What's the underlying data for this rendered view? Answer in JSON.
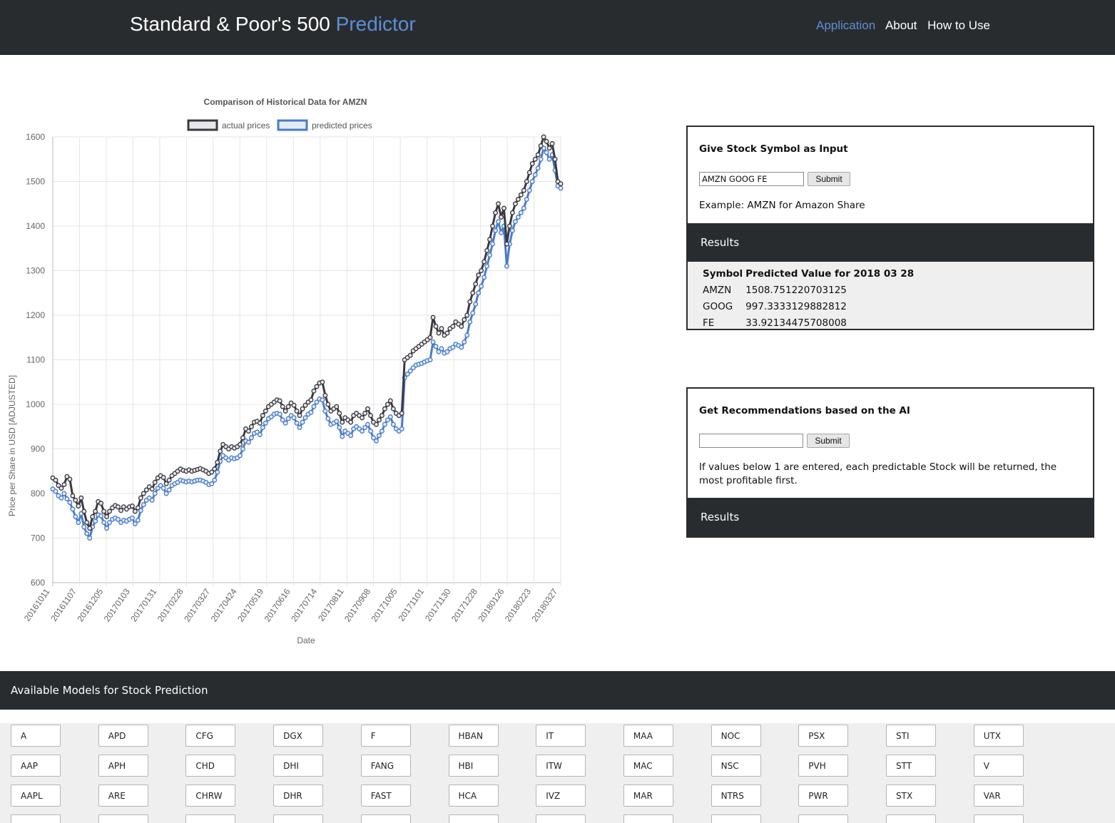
{
  "nav": {
    "brand_main": "Standard & Poor's 500",
    "brand_accent": "Predictor",
    "links": [
      "Application",
      "About",
      "How to Use"
    ],
    "active_link": "Application"
  },
  "chart_data": {
    "type": "line",
    "title": "Comparison of Historical Data for AMZN",
    "xlabel": "Date",
    "ylabel": "Price per Share in USD [ADJUSTED]",
    "ylim": [
      600,
      1600
    ],
    "yticks": [
      600,
      700,
      800,
      900,
      1000,
      1100,
      1200,
      1300,
      1400,
      1500,
      1600
    ],
    "xtick_labels": [
      "20161011",
      "20161107",
      "20161205",
      "20170103",
      "20170131",
      "20170228",
      "20170327",
      "20170424",
      "20170519",
      "20170616",
      "20170714",
      "20170811",
      "20170908",
      "20171005",
      "20171101",
      "20171130",
      "20171228",
      "20180126",
      "20180223",
      "20180327"
    ],
    "grid": true,
    "legend_position": "top",
    "series": [
      {
        "name": "actual prices",
        "color": "#3a3941",
        "values": [
          835,
          830,
          818,
          812,
          820,
          838,
          832,
          795,
          785,
          772,
          790,
          760,
          735,
          722,
          748,
          760,
          782,
          778,
          760,
          748,
          760,
          768,
          773,
          770,
          762,
          770,
          765,
          770,
          772,
          760,
          768,
          790,
          800,
          808,
          815,
          810,
          825,
          835,
          840,
          836,
          822,
          830,
          840,
          845,
          850,
          855,
          852,
          850,
          853,
          850,
          852,
          854,
          856,
          853,
          850,
          845,
          848,
          855,
          870,
          895,
          910,
          905,
          900,
          905,
          902,
          905,
          910,
          925,
          945,
          940,
          950,
          960,
          962,
          958,
          975,
          985,
          995,
          1000,
          1005,
          1010,
          1008,
          995,
          985,
          995,
          1003,
          998,
          985,
          975,
          990,
          998,
          1005,
          1010,
          1030,
          1040,
          1048,
          1050,
          1020,
          1000,
          985,
          990,
          995,
          980,
          960,
          970,
          965,
          960,
          975,
          980,
          975,
          970,
          980,
          990,
          975,
          960,
          955,
          965,
          975,
          990,
          1000,
          1008,
          990,
          980,
          975,
          980,
          1100,
          1105,
          1110,
          1120,
          1125,
          1130,
          1135,
          1140,
          1145,
          1150,
          1195,
          1175,
          1160,
          1170,
          1155,
          1160,
          1170,
          1175,
          1185,
          1180,
          1175,
          1190,
          1200,
          1230,
          1250,
          1270,
          1290,
          1300,
          1320,
          1345,
          1370,
          1400,
          1430,
          1450,
          1420,
          1440,
          1360,
          1400,
          1430,
          1450,
          1460,
          1470,
          1480,
          1500,
          1520,
          1540,
          1550,
          1560,
          1580,
          1600,
          1590,
          1575,
          1585,
          1550,
          1500,
          1495
        ]
      },
      {
        "name": "predicted prices",
        "color": "#4a7cc9",
        "values": [
          810,
          805,
          795,
          790,
          800,
          788,
          780,
          765,
          748,
          735,
          755,
          725,
          710,
          700,
          725,
          738,
          752,
          750,
          735,
          722,
          735,
          742,
          745,
          742,
          735,
          740,
          738,
          742,
          745,
          732,
          740,
          762,
          775,
          785,
          790,
          785,
          800,
          812,
          818,
          812,
          800,
          808,
          818,
          822,
          825,
          830,
          828,
          826,
          828,
          826,
          828,
          830,
          830,
          828,
          825,
          820,
          822,
          830,
          848,
          872,
          885,
          880,
          875,
          880,
          878,
          880,
          885,
          900,
          918,
          915,
          925,
          935,
          938,
          932,
          948,
          958,
          968,
          972,
          978,
          980,
          978,
          965,
          958,
          968,
          975,
          970,
          958,
          948,
          960,
          970,
          978,
          982,
          995,
          1005,
          1012,
          1010,
          985,
          968,
          955,
          958,
          962,
          948,
          928,
          940,
          935,
          930,
          945,
          950,
          945,
          940,
          948,
          955,
          940,
          925,
          918,
          930,
          940,
          955,
          965,
          972,
          955,
          945,
          940,
          945,
          1060,
          1068,
          1075,
          1082,
          1088,
          1090,
          1092,
          1095,
          1098,
          1100,
          1140,
          1130,
          1118,
          1125,
          1115,
          1118,
          1125,
          1128,
          1135,
          1132,
          1128,
          1140,
          1155,
          1185,
          1205,
          1225,
          1250,
          1265,
          1285,
          1310,
          1335,
          1360,
          1390,
          1410,
          1385,
          1400,
          1310,
          1360,
          1390,
          1410,
          1420,
          1430,
          1440,
          1460,
          1480,
          1500,
          1515,
          1530,
          1550,
          1575,
          1565,
          1550,
          1560,
          1525,
          1490,
          1485
        ]
      }
    ]
  },
  "input_panel": {
    "title": "Give Stock Symbol as Input",
    "input_value": "AMZN GOOG FE",
    "submit_label": "Submit",
    "example_text": "Example: AMZN for Amazon Share",
    "results_label": "Results",
    "table_headers": [
      "Symbol",
      "Predicted Value for 2018 03 28"
    ],
    "rows": [
      [
        "AMZN",
        "1508.751220703125"
      ],
      [
        "GOOG",
        "997.3333129882812"
      ],
      [
        "FE",
        "33.92134475708008"
      ]
    ]
  },
  "recommend_panel": {
    "title": "Get Recommendations based on the AI",
    "input_value": "",
    "submit_label": "Submit",
    "note": "If values below 1 are entered, each predictable Stock will be returned, the most profitable first.",
    "results_label": "Results"
  },
  "models": {
    "title": "Available Models for Stock Prediction",
    "columns": [
      [
        "A",
        "AAP",
        "AAPL"
      ],
      [
        "APD",
        "APH",
        "ARE"
      ],
      [
        "CFG",
        "CHD",
        "CHRW"
      ],
      [
        "DGX",
        "DHI",
        "DHR"
      ],
      [
        "F",
        "FANG",
        "FAST"
      ],
      [
        "HBAN",
        "HBI",
        "HCA"
      ],
      [
        "IT",
        "ITW",
        "IVZ"
      ],
      [
        "MAA",
        "MAC",
        "MAR"
      ],
      [
        "NOC",
        "NSC",
        "NTRS"
      ],
      [
        "PSX",
        "PVH",
        "PWR"
      ],
      [
        "STI",
        "STT",
        "STX"
      ],
      [
        "UTX",
        "V",
        "VAR"
      ]
    ]
  }
}
